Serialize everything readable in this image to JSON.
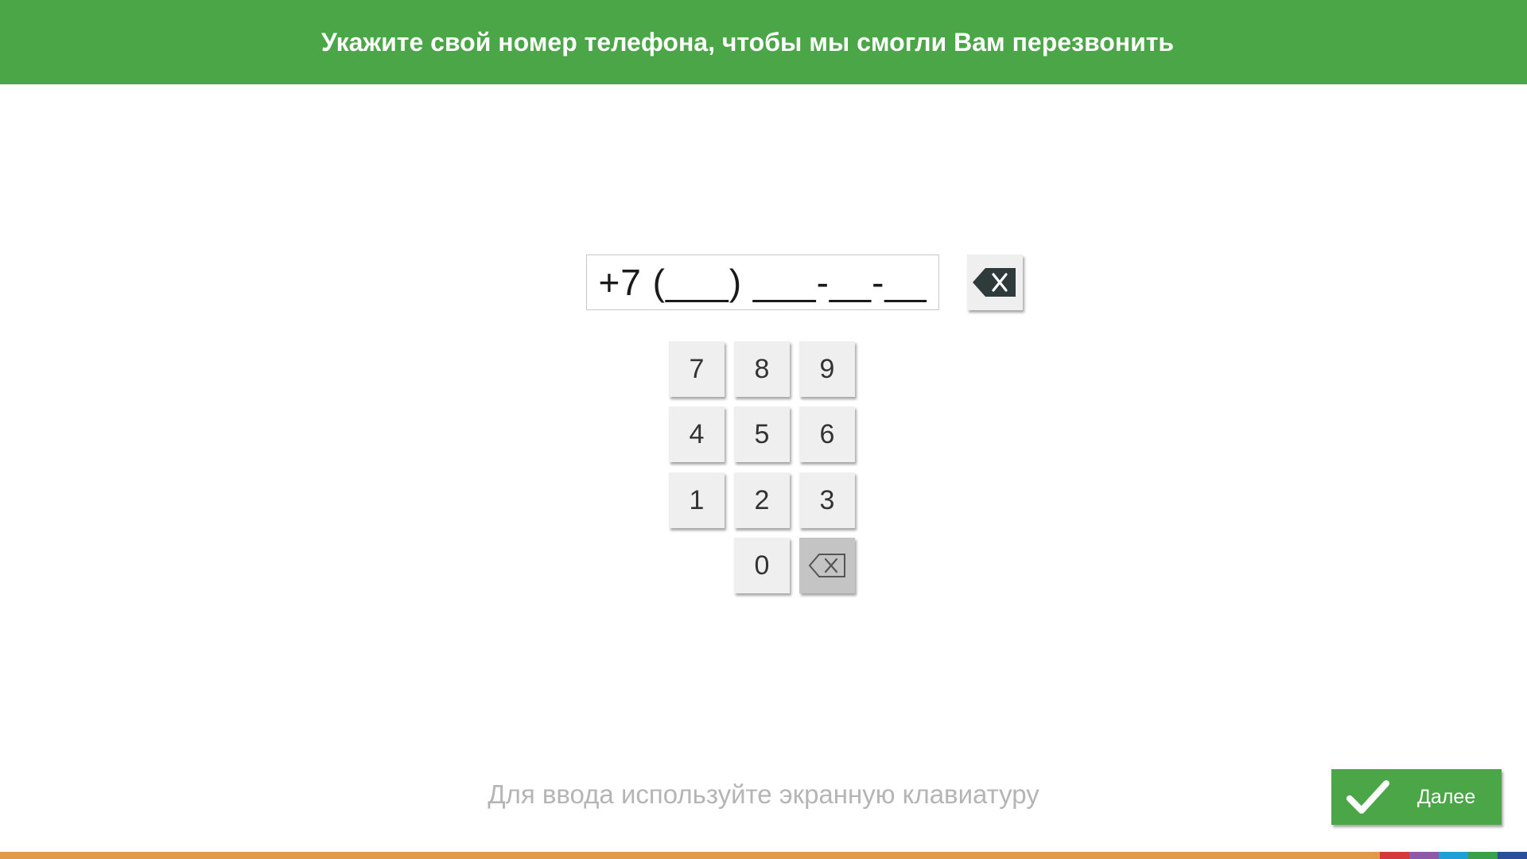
{
  "header": {
    "title": "Укажите свой номер телефона, чтобы мы смогли Вам перезвонить"
  },
  "phone": {
    "value": "+7 (___) ___-__-__",
    "clear_icon": "backspace-filled-icon"
  },
  "keypad": {
    "keys": [
      "7",
      "8",
      "9",
      "4",
      "5",
      "6",
      "1",
      "2",
      "3",
      "0"
    ],
    "backspace_icon": "backspace-outline-icon"
  },
  "hint": "Для ввода используйте экранную клавиатуру",
  "next_button": {
    "label": "Далее",
    "icon": "checkmark-icon"
  },
  "colors": {
    "header_bg": "#4aa646",
    "button_bg": "#efefef",
    "backspace_key_bg": "#c4c4c4",
    "footer_orange": "#e09a4a",
    "footer_accents": [
      "#d43a3a",
      "#8e5aa8",
      "#1e9fd6",
      "#3aa14a",
      "#2a4f9a"
    ]
  }
}
